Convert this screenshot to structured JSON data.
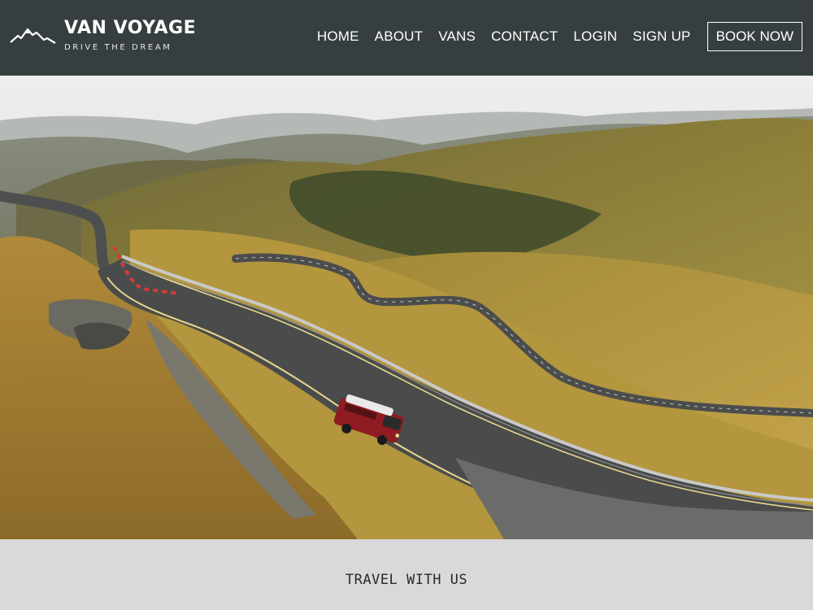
{
  "brand": {
    "name": "VAN VOYAGE",
    "tagline": "DRIVE THE DREAM",
    "logo_icon": "mountain-icon"
  },
  "nav": {
    "items": [
      {
        "label": "HOME",
        "active": true
      },
      {
        "label": "ABOUT",
        "active": false
      },
      {
        "label": "VANS",
        "active": false
      },
      {
        "label": "CONTACT",
        "active": false
      },
      {
        "label": "LOGIN",
        "active": false
      },
      {
        "label": "SIGN UP",
        "active": false
      }
    ],
    "cta_label": "BOOK NOW"
  },
  "section": {
    "title": "TRAVEL WITH US"
  },
  "colors": {
    "navbar_bg": "#363e3f",
    "section_bg": "#d9d9d9",
    "text_light": "#ffffff",
    "van_red": "#8e1c22"
  }
}
